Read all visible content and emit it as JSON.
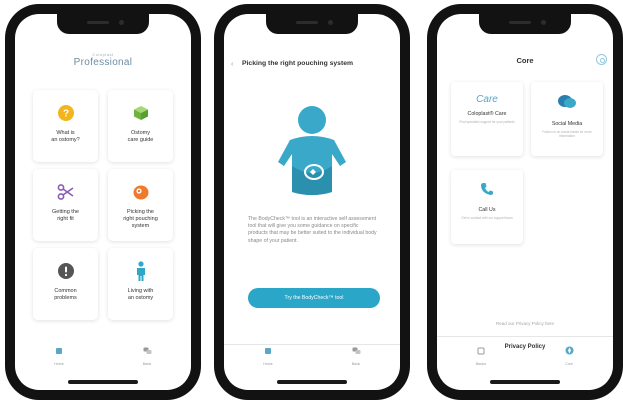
{
  "screens": [
    {
      "logo": {
        "small": "Coloplast",
        "big": "Professional"
      },
      "tiles": [
        {
          "label": "What is\nan ostomy?",
          "icon": "question-icon",
          "color": "#f2b51d"
        },
        {
          "label": "Ostomy\ncare guide",
          "icon": "box-icon",
          "color": "#7cc14a"
        },
        {
          "label": "Getting the\nright fit",
          "icon": "scissors-icon",
          "color": "#8a5db3"
        },
        {
          "label": "Picking the\nright pouching\nsystem",
          "icon": "pouch-icon",
          "color": "#f07a2c"
        },
        {
          "label": "Common\nproblems",
          "icon": "alert-icon",
          "color": "#555555"
        },
        {
          "label": "Living with\nan ostomy",
          "icon": "person-icon",
          "color": "#2fa8c8"
        }
      ],
      "tabs": [
        {
          "label": "Home",
          "icon": "home-icon"
        },
        {
          "label": "Basic",
          "icon": "chat-icon"
        }
      ]
    },
    {
      "title": "Picking the right pouching system",
      "paragraph": "The BodyCheck™ tool is an interactive self assessment tool that will give you some guidance on specific products that may be better suited to the individual body shape of your patient.",
      "button": "Try the BodyCheck™ tool",
      "tabs": [
        {
          "label": "Home",
          "icon": "home-icon"
        },
        {
          "label": "Basic",
          "icon": "chat-icon"
        }
      ]
    },
    {
      "title": "Core",
      "cards": [
        {
          "title": "Coloplast® Care",
          "desc": "Find specialist support for your patients",
          "icon": "care-logo-icon",
          "logo_text": "Care"
        },
        {
          "title": "Social Media",
          "desc": "Follow us on social media for more information",
          "icon": "speech-bubbles-icon"
        },
        {
          "title": "Call Us",
          "desc": "Get in contact with our support team",
          "icon": "phone-icon"
        }
      ],
      "privacy_link": "Read our Privacy Policy here",
      "privacy_title": "Privacy Policy",
      "tabs": [
        {
          "label": "Basics",
          "icon": "book-icon"
        },
        {
          "label": "Core",
          "icon": "compass-icon"
        }
      ]
    }
  ],
  "colors": {
    "accent": "#2aa6c9",
    "frame": "#121212"
  }
}
